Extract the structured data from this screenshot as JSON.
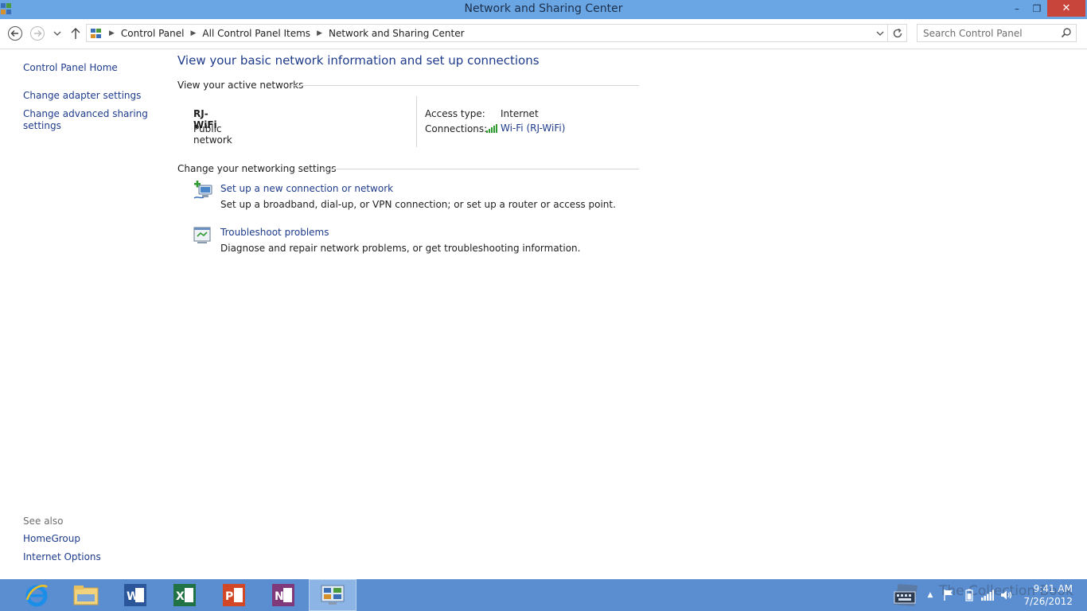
{
  "window": {
    "title": "Network and Sharing Center",
    "controls": {
      "minimize": "–",
      "maximize": "❐",
      "close": "✕"
    }
  },
  "address_bar": {
    "breadcrumbs": [
      "Control Panel",
      "All Control Panel Items",
      "Network and Sharing Center"
    ],
    "search_placeholder": "Search Control Panel"
  },
  "left_panel": {
    "links": [
      "Control Panel Home",
      "Change adapter settings",
      "Change advanced sharing",
      "settings"
    ],
    "see_also_label": "See also",
    "see_also_links": [
      "HomeGroup",
      "Internet Options"
    ]
  },
  "main": {
    "title": "View your basic network information and set up connections",
    "active_networks": {
      "heading": "View your active networks",
      "network_name": "RJ-WiFi",
      "network_type": "Public network",
      "access_type_label": "Access type:",
      "access_type_value": "Internet",
      "connections_label": "Connections:",
      "connection_link": "Wi-Fi (RJ-WiFi)"
    },
    "networking_settings": {
      "heading": "Change your networking settings",
      "tasks": [
        {
          "link": "Set up a new connection or network",
          "description": "Set up a broadband, dial-up, or VPN connection; or set up a router or access point."
        },
        {
          "link": "Troubleshoot problems",
          "description": "Diagnose and repair network problems, or get troubleshooting information."
        }
      ]
    }
  },
  "taskbar": {
    "apps": [
      "internet-explorer",
      "file-explorer",
      "word",
      "excel",
      "powerpoint",
      "onenote",
      "control-panel"
    ],
    "active_app": "control-panel",
    "clock_time": "9:41 AM",
    "clock_date": "7/26/2012",
    "watermark": "The Collection Book"
  },
  "colors": {
    "titlebar": "#6aa6e4",
    "taskbar": "#5a8ed1",
    "link": "#1e3b8c",
    "close": "#c7453b"
  }
}
